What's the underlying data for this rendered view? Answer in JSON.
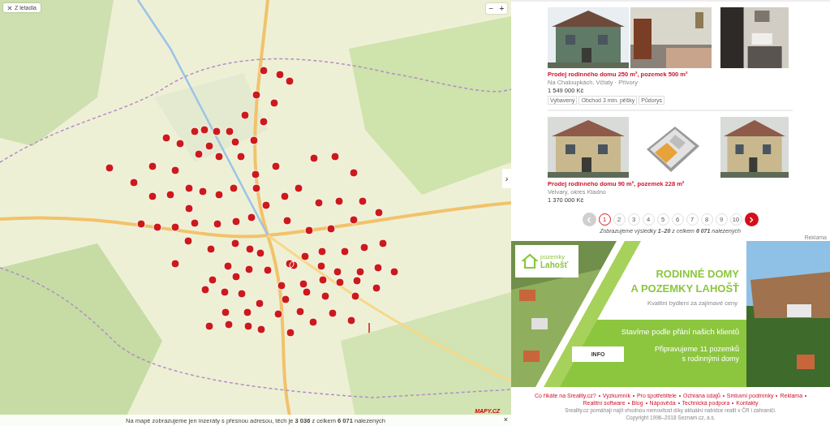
{
  "map": {
    "view_button": "Z letadla",
    "zoom_out": "−",
    "zoom_in": "+",
    "side_toggle": "›",
    "logo": "MAPY.CZ",
    "notice": "Na mapě zobrazujeme jen inzeráty s přesnou adresou, těch je **3 036** z celkem **6 071** nalezených",
    "notice_close": "×"
  },
  "listings": [
    {
      "title": "Prodej rodinného domu 250 m², pozemek 500 m²",
      "location": "Na Chaloupkách, Včtaty · Přívory",
      "price": "1 549 000 Kč",
      "tags": [
        "Vybavený",
        "Obchod 3 min. pěšky",
        "Půdorys"
      ]
    },
    {
      "title": "Prodej rodinného domu 90 m², pozemek 228 m²",
      "location": "Velvary, okres Kladno",
      "price": "1 370 000 Kč"
    }
  ],
  "pagination": {
    "prev": {
      "disabled": true
    },
    "next": {
      "disabled": false
    },
    "pages": [
      {
        "label": "1",
        "selected": true
      },
      {
        "label": "2",
        "selected": false
      },
      {
        "label": "3",
        "selected": false
      },
      {
        "label": "4",
        "selected": false
      },
      {
        "label": "5",
        "selected": false
      },
      {
        "label": "6",
        "selected": false
      },
      {
        "label": "7",
        "selected": false
      },
      {
        "label": "8",
        "selected": false
      },
      {
        "label": "9",
        "selected": false
      },
      {
        "label": "10",
        "selected": false
      }
    ],
    "summary": "Zobrazujeme výsledky **1–20** z celkem **6 071** nalezených"
  },
  "ad": {
    "label": "Reklama",
    "logo_top": "pozemky",
    "logo_bottom": "Lahošť",
    "headline": [
      "RODINNÉ DOMY",
      "A POZEMKY LAHOŠŤ"
    ],
    "tagline": "Kvalitní bydlení za zajímavé ceny",
    "slogan": "Stavíme podle přání našich klientů",
    "button": "INFO",
    "note": [
      "Připravujeme 11 pozemků",
      "s rodinnými domy"
    ]
  },
  "footer": {
    "links": [
      "Co říkáte na Sreality.cz?",
      "Výzkumník",
      "Pro spotřebitele",
      "Ochrana údajů",
      "Smluvní podmínky",
      "Reklama",
      "Realitní software",
      "Blog",
      "Nápověda",
      "Technická podpora",
      "Kontakty"
    ],
    "description": "Sreality.cz pomáhají najít vhodnou nemovitost díky aktuální nabídce realit v ČR i zahraničí.",
    "copyright": "Copyright 1996–2018 Seznam.cz, a.s."
  }
}
